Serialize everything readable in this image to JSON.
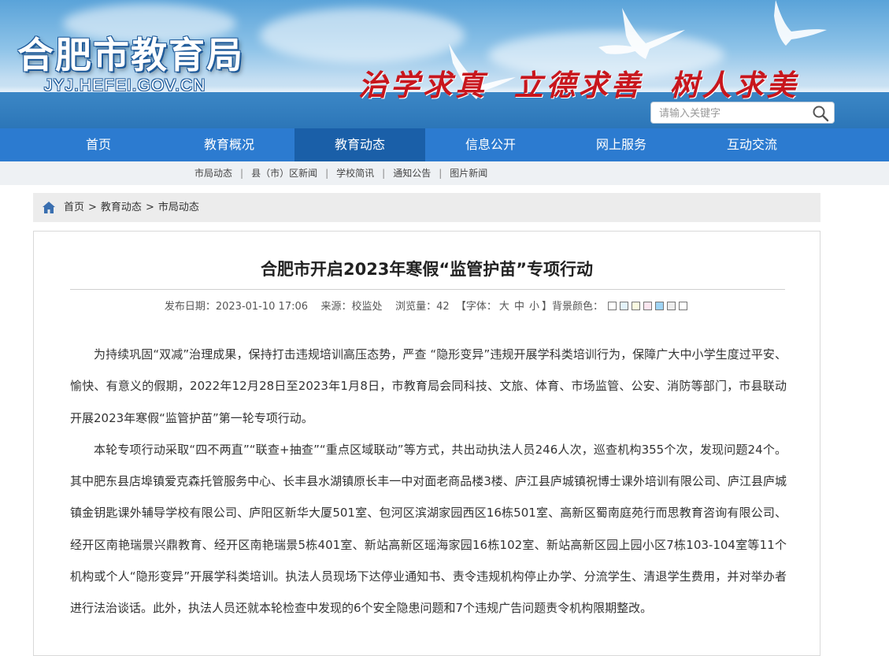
{
  "header": {
    "title": "合肥市教育局",
    "url": "JYJ.HEFEI.GOV.CN",
    "slogan": "治学求真  立德求善  树人求美",
    "search": {
      "placeholder": "请输入关键字",
      "icon": "search-icon"
    }
  },
  "nav": {
    "items": [
      {
        "label": "首页"
      },
      {
        "label": "教育概况"
      },
      {
        "label": "教育动态",
        "active": true
      },
      {
        "label": "信息公开"
      },
      {
        "label": "网上服务"
      },
      {
        "label": "互动交流"
      }
    ]
  },
  "subnav": {
    "items": [
      "市局动态",
      "县（市）区新闻",
      "学校简讯",
      "通知公告",
      "图片新闻"
    ],
    "separator": "|"
  },
  "breadcrumb": {
    "icon": "home-icon",
    "items": [
      "首页",
      "教育动态",
      "市局动态"
    ],
    "separator": ">"
  },
  "article": {
    "title": "合肥市开启2023年寒假“监管护苗”专项行动",
    "meta": {
      "date": "发布日期：2023-01-10 17:06",
      "source": "来源：校监处",
      "views": "浏览量：42",
      "font_label": "【字体：",
      "font_large": "大",
      "font_medium": "中",
      "font_small": "小",
      "font_close": "】",
      "bg_label": "背景颜色：",
      "bg_colors": [
        "#ffffff",
        "#e3f3fb",
        "#fafae0",
        "#fce6f0",
        "#9fd4f5",
        "#eeeeee",
        "#ffffff"
      ]
    },
    "paragraphs": [
      "为持续巩固“双减”治理成果，保持打击违规培训高压态势，严查 “隐形变异”违规开展学科类培训行为，保障广大中小学生度过平安、愉快、有意义的假期，2022年12月28日至2023年1月8日，市教育局会同科技、文旅、体育、市场监管、公安、消防等部门，市县联动开展2023年寒假“监管护苗”第一轮专项行动。",
      "本轮专项行动采取“四不两直”“联查+抽查”“重点区域联动”等方式，共出动执法人员246人次，巡查机构355个次，发现问题24个。其中肥东县店埠镇爱克森托管服务中心、长丰县水湖镇原长丰一中对面老商品楼3楼、庐江县庐城镇祝博士课外培训有限公司、庐江县庐城镇金钥匙课外辅导学校有限公司、庐阳区新华大厦501室、包河区滨湖家园西区16栋501室、高新区蜀南庭苑行而思教育咨询有限公司、经开区南艳瑞景兴鼎教育、经开区南艳瑞景5栋401室、新站高新区瑶海家园16栋102室、新站高新区园上园小区7栋103-104室等11个机构或个人“隐形变异”开展学科类培训。执法人员现场下达停业通知书、责令违规机构停止办学、分流学生、清退学生费用，并对举办者进行法治谈话。此外，执法人员还就本轮检查中发现的6个安全隐患问题和7个违规广告问题责令机构限期整改。"
    ]
  }
}
